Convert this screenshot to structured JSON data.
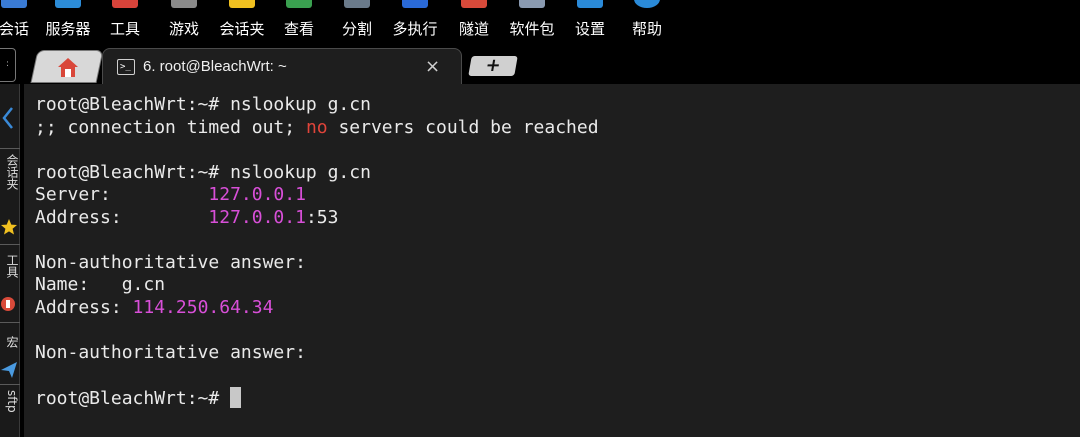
{
  "menubar": {
    "items": [
      {
        "label": "会话",
        "icon": "session-icon",
        "color": "#3a7bd5"
      },
      {
        "label": "服务器",
        "icon": "server-icon",
        "color": "#2c8cd8"
      },
      {
        "label": "工具",
        "icon": "tools-icon",
        "color": "#d8433a"
      },
      {
        "label": "游戏",
        "icon": "gamepad-icon",
        "color": "#8a8a8a"
      },
      {
        "label": "会话夹",
        "icon": "star-icon",
        "color": "#f0c020"
      },
      {
        "label": "查看",
        "icon": "view-icon",
        "color": "#3aa050"
      },
      {
        "label": "分割",
        "icon": "split-icon",
        "color": "#6a7a8a"
      },
      {
        "label": "多执行",
        "icon": "multiexec-icon",
        "color": "#2a6ad8"
      },
      {
        "label": "隧道",
        "icon": "tunnel-icon",
        "color": "#d84a3a"
      },
      {
        "label": "软件包",
        "icon": "package-icon",
        "color": "#8a9ab0"
      },
      {
        "label": "设置",
        "icon": "gear-icon",
        "color": "#2a8ad8"
      },
      {
        "label": "帮助",
        "icon": "help-icon",
        "color": "#2a8ad8"
      }
    ]
  },
  "tabs": {
    "active_title": "6. root@BleachWrt: ~",
    "close_glyph": "×",
    "new_tab_glyph": "+"
  },
  "sidebar": {
    "sections": [
      "会话夹",
      "工具",
      "宏",
      "sftp"
    ]
  },
  "terminal": {
    "prompt": "root@BleachWrt:~# ",
    "lines": [
      {
        "segments": [
          {
            "text": "root@BleachWrt:~# nslookup g.cn",
            "style": ""
          }
        ]
      },
      {
        "segments": [
          {
            "text": ";; connection timed out; ",
            "style": ""
          },
          {
            "text": "no",
            "style": "red"
          },
          {
            "text": " servers could be reached",
            "style": ""
          }
        ]
      },
      {
        "segments": [
          {
            "text": "",
            "style": ""
          }
        ]
      },
      {
        "segments": [
          {
            "text": "root@BleachWrt:~# nslookup g.cn",
            "style": ""
          }
        ]
      },
      {
        "segments": [
          {
            "text": "Server:         ",
            "style": ""
          },
          {
            "text": "127.0.0.1",
            "style": "mag"
          }
        ]
      },
      {
        "segments": [
          {
            "text": "Address:        ",
            "style": ""
          },
          {
            "text": "127.0.0.1",
            "style": "mag"
          },
          {
            "text": ":53",
            "style": ""
          }
        ]
      },
      {
        "segments": [
          {
            "text": "",
            "style": ""
          }
        ]
      },
      {
        "segments": [
          {
            "text": "Non-authoritative answer:",
            "style": ""
          }
        ]
      },
      {
        "segments": [
          {
            "text": "Name:   g.cn",
            "style": ""
          }
        ]
      },
      {
        "segments": [
          {
            "text": "Address: ",
            "style": ""
          },
          {
            "text": "114.250.64.34",
            "style": "mag"
          }
        ]
      },
      {
        "segments": [
          {
            "text": "",
            "style": ""
          }
        ]
      },
      {
        "segments": [
          {
            "text": "Non-authoritative answer:",
            "style": ""
          }
        ]
      },
      {
        "segments": [
          {
            "text": "",
            "style": ""
          }
        ]
      },
      {
        "segments": [
          {
            "text": "root@BleachWrt:~# ",
            "style": ""
          }
        ]
      }
    ]
  },
  "colors": {
    "terminal_bg": "#1e1e1e",
    "text": "#eaeaea",
    "error_red": "#e0443a",
    "ip_magenta": "#d84fd8"
  }
}
